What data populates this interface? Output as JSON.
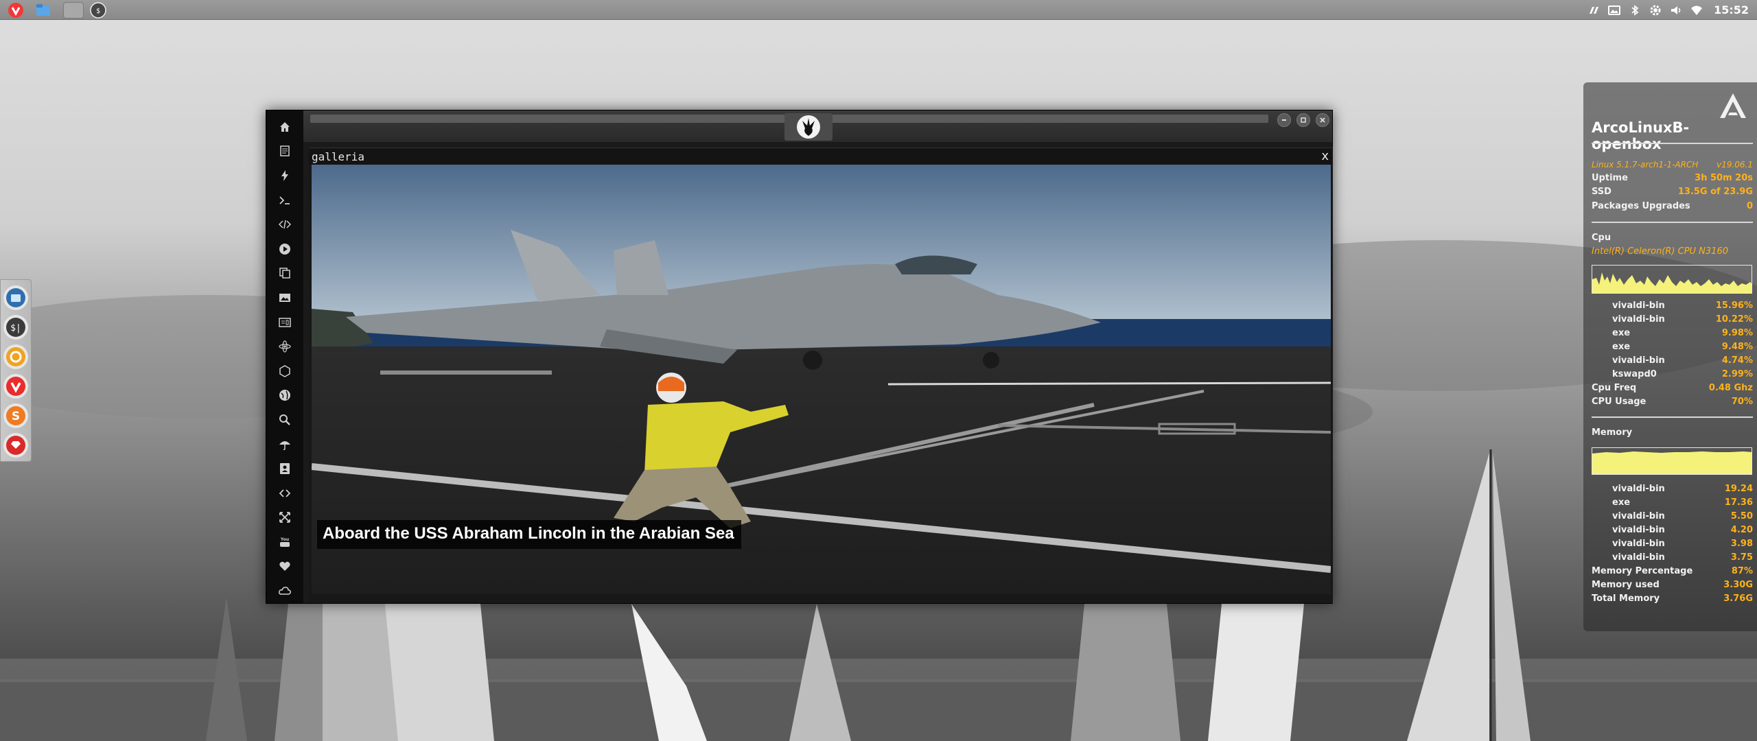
{
  "panel": {
    "clock": "15:52",
    "launchers": [
      "vivaldi-icon",
      "files-icon",
      "desktop-icon",
      "terminal-icon"
    ],
    "tray_icons": [
      "fan-icon",
      "image-icon",
      "bluetooth-icon",
      "settings-icon",
      "volume-icon",
      "wifi-icon"
    ]
  },
  "dock": {
    "items": [
      "files-icon",
      "terminal-icon",
      "settings-icon",
      "vivaldi-icon",
      "sublime-icon",
      "ruby-icon"
    ]
  },
  "window": {
    "sidebar_icons": [
      "home-icon",
      "document-icon",
      "lightning-icon",
      "terminal-icon",
      "code-icon",
      "play-icon",
      "copy-icon",
      "image-icon",
      "id-card-icon",
      "atom-icon",
      "hexagon-icon",
      "globe-icon",
      "search-icon",
      "umbrella-icon",
      "contact-icon",
      "link-icon",
      "expand-icon",
      "youtube-icon",
      "heart-icon",
      "cloud-icon"
    ],
    "gallery": {
      "title": "galleria",
      "close": "x",
      "caption": "Aboard the USS Abraham Lincoln in the Arabian Sea"
    }
  },
  "conky": {
    "hostname": "ArcoLinuxB-openbox",
    "kernel": "Linux 5.1.7-arch1-1-ARCH",
    "version": "v19.06.1",
    "uptime_label": "Uptime",
    "uptime_value": "3h 50m 20s",
    "ssd_label": "SSD",
    "ssd_value": "13.5G of 23.9G",
    "packages_label": "Packages Upgrades",
    "packages_value": "0",
    "cpu_label": "Cpu",
    "cpu_model": "Intel(R) Celeron(R) CPU  N3160",
    "cpu_processes": [
      {
        "name": "vivaldi-bin",
        "value": "15.96%"
      },
      {
        "name": "vivaldi-bin",
        "value": "10.22%"
      },
      {
        "name": "exe",
        "value": "9.98%"
      },
      {
        "name": "exe",
        "value": "9.48%"
      },
      {
        "name": "vivaldi-bin",
        "value": "4.74%"
      },
      {
        "name": "kswapd0",
        "value": "2.99%"
      }
    ],
    "cpu_freq_label": "Cpu Freq",
    "cpu_freq_value": "0.48 Ghz",
    "cpu_usage_label": "CPU Usage",
    "cpu_usage_value": "70%",
    "memory_label": "Memory",
    "mem_processes": [
      {
        "name": "vivaldi-bin",
        "value": "19.24"
      },
      {
        "name": "exe",
        "value": "17.36"
      },
      {
        "name": "vivaldi-bin",
        "value": "5.50"
      },
      {
        "name": "vivaldi-bin",
        "value": "4.20"
      },
      {
        "name": "vivaldi-bin",
        "value": "3.98"
      },
      {
        "name": "vivaldi-bin",
        "value": "3.75"
      }
    ],
    "mem_percentage_label": "Memory Percentage",
    "mem_percentage_value": "87%",
    "mem_used_label": "Memory used",
    "mem_used_value": "3.30G",
    "mem_total_label": "Total Memory",
    "mem_total_value": "3.76G",
    "accent_color": "#ffb21a",
    "graph_color": "#f4f27a"
  }
}
